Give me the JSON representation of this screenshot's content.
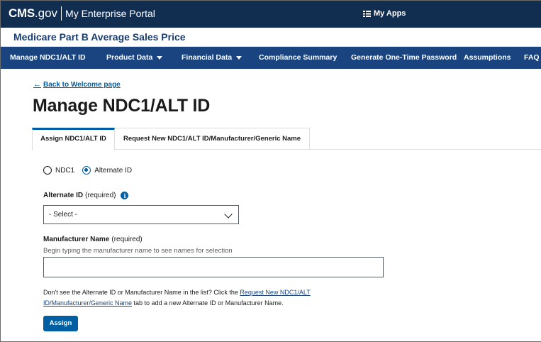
{
  "header": {
    "logo_cms": "CMS",
    "logo_gov": ".gov",
    "portal": "My Enterprise Portal",
    "my_apps": "My Apps",
    "my_apps_icon": "grid-menu-icon"
  },
  "app": {
    "title": "Medicare Part B Average Sales Price"
  },
  "nav": {
    "items": [
      {
        "label": "Manage NDC1/ALT ID"
      },
      {
        "label": "Product Data"
      },
      {
        "label": "Financial Data"
      },
      {
        "label": "Compliance Summary"
      },
      {
        "label": "Generate One-Time Password"
      },
      {
        "label": "Assumptions"
      },
      {
        "label": "FAQ"
      }
    ]
  },
  "content": {
    "back_link": "Back to Welcome page",
    "page_title": "Manage NDC1/ALT ID",
    "tabs": [
      {
        "label": "Assign NDC1/ALT ID",
        "active": true
      },
      {
        "label": "Request New NDC1/ALT ID/Manufacturer/Generic Name",
        "active": false
      }
    ],
    "radio": {
      "options": [
        "NDC1",
        "Alternate ID"
      ],
      "selected": "Alternate ID"
    },
    "alt_id": {
      "label": "Alternate ID",
      "required": "(required)",
      "select_value": "- Select -"
    },
    "manufacturer": {
      "label": "Manufacturer Name",
      "required": "(required)",
      "hint": "Begin typing the manufacturer name to see names for selection",
      "value": ""
    },
    "help": {
      "before": "Don't see the Alternate ID or Manufacturer Name in the list? Click the ",
      "link": "Request New NDC1/ALT ID/Manufacturer/Generic Name",
      "after": " tab to add a new Alternate ID or Manufacturer Name."
    },
    "assign_button": "Assign"
  },
  "colors": {
    "header_bg": "#112e51",
    "nav_bg": "#1a4480",
    "primary": "#005ea2",
    "app_title": "#1a3d6e"
  }
}
